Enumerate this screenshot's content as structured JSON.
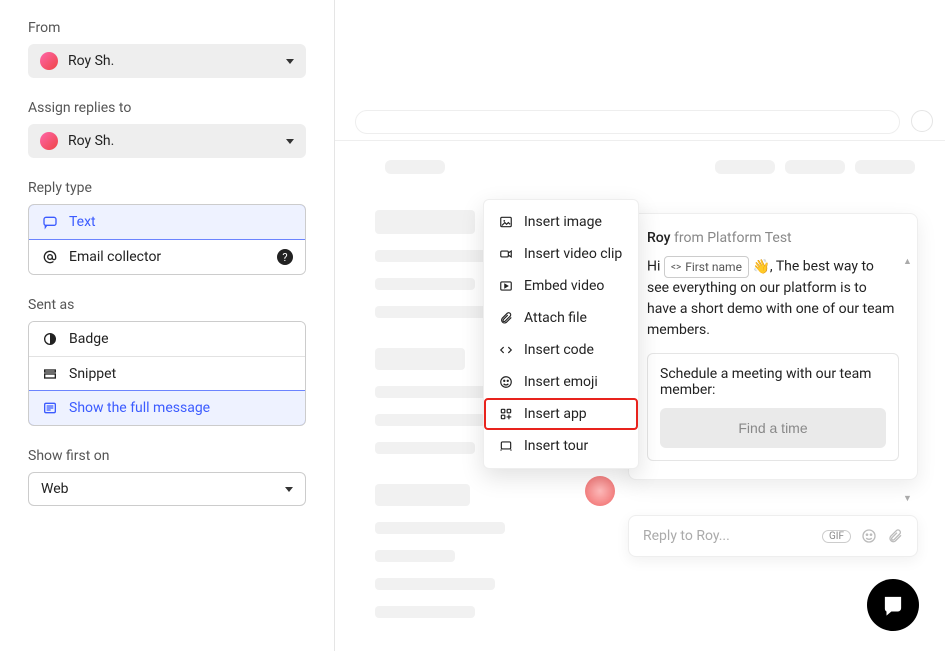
{
  "form": {
    "from_label": "From",
    "from_value": "Roy Sh.",
    "assign_label": "Assign replies to",
    "assign_value": "Roy Sh.",
    "reply_type_label": "Reply type",
    "reply_type": [
      {
        "key": "text",
        "label": "Text",
        "selected": true,
        "icon": "chat-icon"
      },
      {
        "key": "email",
        "label": "Email collector",
        "selected": false,
        "icon": "at-icon",
        "help": true
      }
    ],
    "sent_as_label": "Sent as",
    "sent_as": [
      {
        "key": "badge",
        "label": "Badge",
        "selected": false,
        "icon": "badge-icon"
      },
      {
        "key": "snippet",
        "label": "Snippet",
        "selected": false,
        "icon": "snippet-icon"
      },
      {
        "key": "full",
        "label": "Show the full message",
        "selected": true,
        "icon": "message-icon"
      }
    ],
    "show_first_label": "Show first on",
    "show_first_value": "Web"
  },
  "insert_menu": [
    {
      "key": "image",
      "label": "Insert image",
      "icon": "image-icon"
    },
    {
      "key": "videoclip",
      "label": "Insert video clip",
      "icon": "camera-icon"
    },
    {
      "key": "embed",
      "label": "Embed video",
      "icon": "play-icon"
    },
    {
      "key": "attach",
      "label": "Attach file",
      "icon": "paperclip-icon"
    },
    {
      "key": "code",
      "label": "Insert code",
      "icon": "code-icon"
    },
    {
      "key": "emoji",
      "label": "Insert emoji",
      "icon": "emoji-icon"
    },
    {
      "key": "app",
      "label": "Insert app",
      "icon": "app-icon",
      "highlight": true
    },
    {
      "key": "tour",
      "label": "Insert tour",
      "icon": "tour-icon"
    }
  ],
  "message": {
    "author_name": "Roy",
    "author_suffix": "from Platform Test",
    "hi": "Hi ",
    "token_label": "First name",
    "wave": "👋",
    "body_rest": ", The best way to see everything on our platform is to have a short demo with one of our team members.",
    "scheduler_label": "Schedule a meeting with our team member:",
    "find_time": "Find a time"
  },
  "reply": {
    "placeholder": "Reply to Roy...",
    "gif_label": "GIF"
  }
}
